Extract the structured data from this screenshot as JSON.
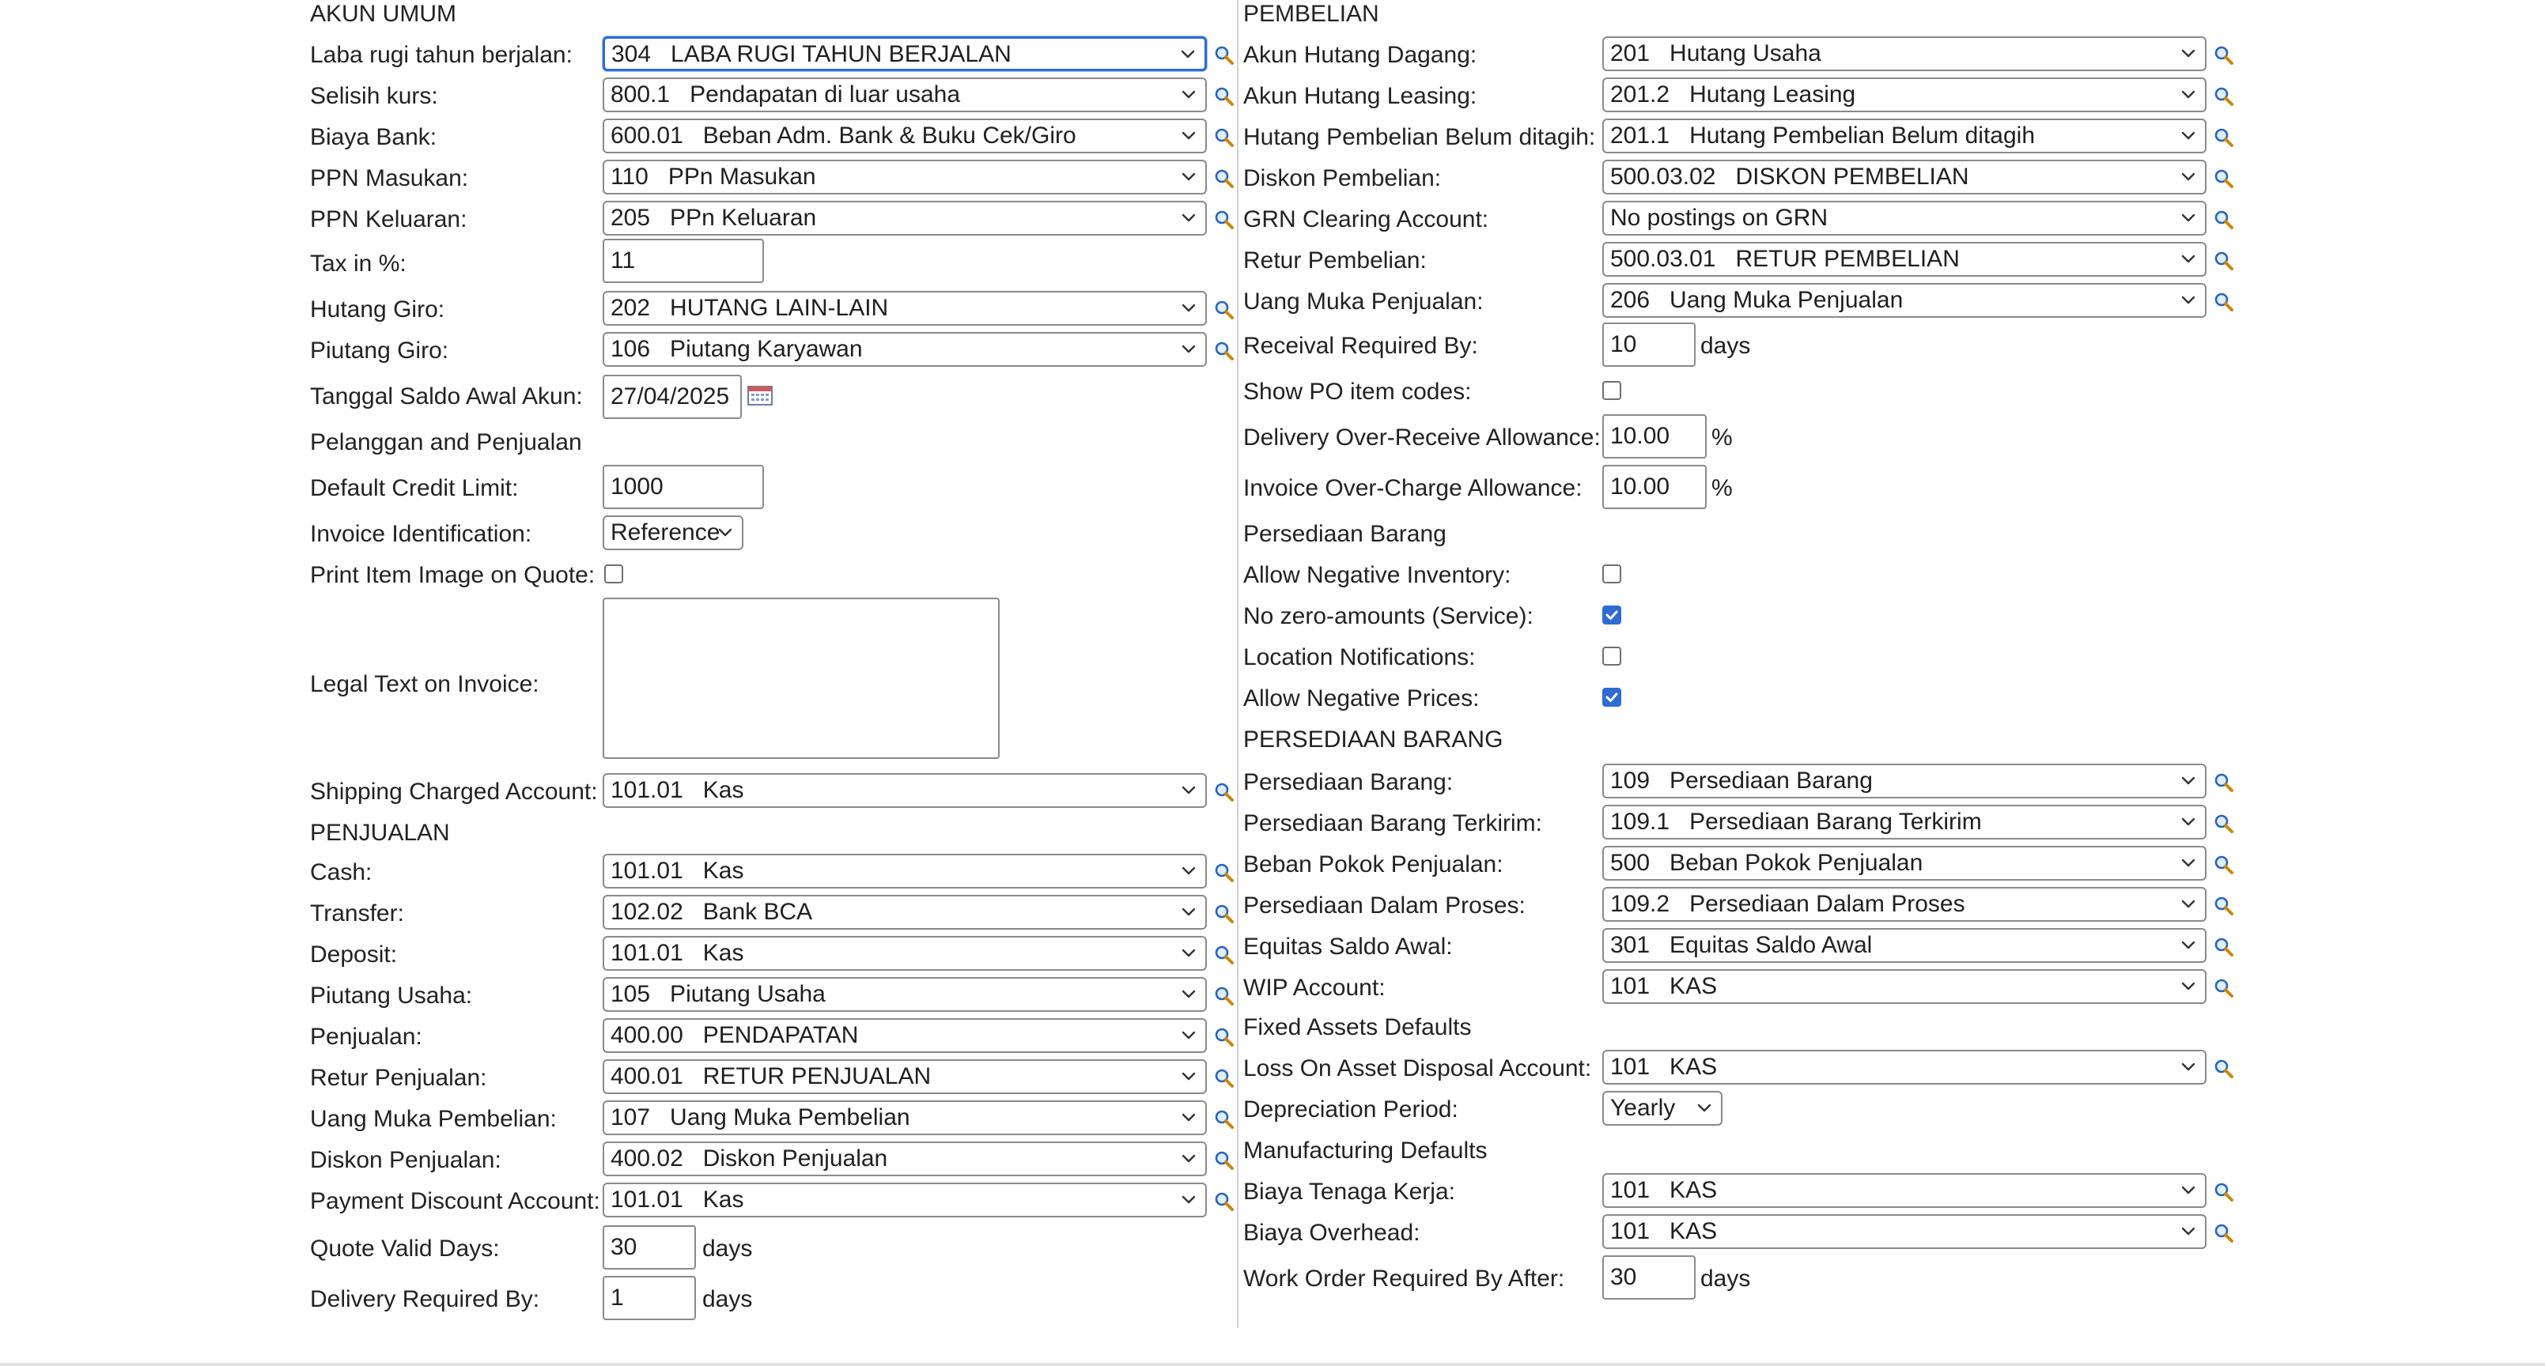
{
  "left": {
    "akun_umum_header": "AKUN UMUM",
    "laba_rugi_label": "Laba rugi tahun berjalan:",
    "laba_rugi_value": "304   LABA RUGI TAHUN BERJALAN",
    "selisih_kurs_label": "Selisih kurs:",
    "selisih_kurs_value": "800.1   Pendapatan di luar usaha",
    "biaya_bank_label": "Biaya Bank:",
    "biaya_bank_value": "600.01   Beban Adm. Bank & Buku Cek/Giro",
    "ppn_masukan_label": "PPN Masukan:",
    "ppn_masukan_value": "110   PPn Masukan",
    "ppn_keluaran_label": "PPN Keluaran:",
    "ppn_keluaran_value": "205   PPn Keluaran",
    "tax_label": "Tax in %:",
    "tax_value": "11",
    "hutang_giro_label": "Hutang Giro:",
    "hutang_giro_value": "202   HUTANG LAIN-LAIN",
    "piutang_giro_label": "Piutang Giro:",
    "piutang_giro_value": "106   Piutang Karyawan",
    "tanggal_label": "Tanggal Saldo Awal Akun:",
    "tanggal_value": "27/04/2025",
    "pelanggan_header": "Pelanggan and Penjualan",
    "credit_limit_label": "Default Credit Limit:",
    "credit_limit_value": "1000",
    "invoice_id_label": "Invoice Identification:",
    "invoice_id_value": "Reference",
    "print_image_label": "Print Item Image on Quote:",
    "legal_text_label": "Legal Text on Invoice:",
    "shipping_label": "Shipping Charged Account:",
    "shipping_value": "101.01   Kas",
    "penjualan_header": "PENJUALAN",
    "cash_label": "Cash:",
    "cash_value": "101.01   Kas",
    "transfer_label": "Transfer:",
    "transfer_value": "102.02   Bank BCA",
    "deposit_label": "Deposit:",
    "deposit_value": "101.01   Kas",
    "piutang_usaha_label": "Piutang Usaha:",
    "piutang_usaha_value": "105   Piutang Usaha",
    "penjualan_label": "Penjualan:",
    "penjualan_value": "400.00   PENDAPATAN",
    "retur_penjualan_label": "Retur Penjualan:",
    "retur_penjualan_value": "400.01   RETUR PENJUALAN",
    "uang_muka_pembelian_label": "Uang Muka Pembelian:",
    "uang_muka_pembelian_value": "107   Uang Muka Pembelian",
    "diskon_penjualan_label": "Diskon Penjualan:",
    "diskon_penjualan_value": "400.02   Diskon Penjualan",
    "payment_discount_label": "Payment Discount Account:",
    "payment_discount_value": "101.01   Kas",
    "quote_valid_label": "Quote Valid Days:",
    "quote_valid_value": "30",
    "delivery_required_label": "Delivery Required By:",
    "delivery_required_value": "1",
    "days": "days"
  },
  "right": {
    "pembelian_header": "PEMBELIAN",
    "hutang_dagang_label": "Akun Hutang Dagang:",
    "hutang_dagang_value": "201   Hutang Usaha",
    "hutang_leasing_label": "Akun Hutang Leasing:",
    "hutang_leasing_value": "201.2   Hutang Leasing",
    "hutang_pembelian_label": "Hutang Pembelian Belum ditagih:",
    "hutang_pembelian_value": "201.1   Hutang Pembelian Belum ditagih",
    "diskon_pembelian_label": "Diskon Pembelian:",
    "diskon_pembelian_value": "500.03.02   DISKON PEMBELIAN",
    "grn_label": "GRN Clearing Account:",
    "grn_value": "No postings on GRN",
    "retur_pembelian_label": "Retur Pembelian:",
    "retur_pembelian_value": "500.03.01   RETUR PEMBELIAN",
    "uang_muka_penjualan_label": "Uang Muka Penjualan:",
    "uang_muka_penjualan_value": "206   Uang Muka Penjualan",
    "receival_label": "Receival Required By:",
    "receival_value": "10",
    "show_po_label": "Show PO item codes:",
    "over_receive_label": "Delivery Over-Receive Allowance:",
    "over_receive_value": "10.00",
    "over_charge_label": "Invoice Over-Charge Allowance:",
    "over_charge_value": "10.00",
    "percent": "%",
    "persediaan_header": "Persediaan Barang",
    "neg_inventory_label": "Allow Negative Inventory:",
    "no_zero_label": "No zero-amounts (Service):",
    "location_notif_label": "Location Notifications:",
    "neg_prices_label": "Allow Negative Prices:",
    "persediaan_upper_header": "PERSEDIAAN BARANG",
    "persediaan_barang_label": "Persediaan Barang:",
    "persediaan_barang_value": "109   Persediaan Barang",
    "terkirim_label": "Persediaan Barang Terkirim:",
    "terkirim_value": "109.1   Persediaan Barang Terkirim",
    "beban_pokok_label": "Beban Pokok Penjualan:",
    "beban_pokok_value": "500   Beban Pokok Penjualan",
    "dalam_proses_label": "Persediaan Dalam Proses:",
    "dalam_proses_value": "109.2   Persediaan Dalam Proses",
    "equitas_label": "Equitas Saldo Awal:",
    "equitas_value": "301   Equitas Saldo Awal",
    "wip_label": "WIP Account:",
    "wip_value": "101   KAS",
    "fixed_assets_header": "Fixed Assets Defaults",
    "loss_disposal_label": "Loss On Asset Disposal Account:",
    "loss_disposal_value": "101   KAS",
    "depreciation_label": "Depreciation Period:",
    "depreciation_value": "Yearly",
    "manufacturing_header": "Manufacturing Defaults",
    "tenaga_kerja_label": "Biaya Tenaga Kerja:",
    "tenaga_kerja_value": "101   KAS",
    "overhead_label": "Biaya Overhead:",
    "overhead_value": "101   KAS",
    "work_order_label": "Work Order Required By After:",
    "work_order_value": "30",
    "days": "days"
  },
  "checkboxes": {
    "print_image": false,
    "show_po": false,
    "neg_inventory": false,
    "no_zero": true,
    "location_notif": false,
    "neg_prices": true
  },
  "colors": {
    "focus_border": "#2f6bd1",
    "checkbox_checked": "#2f6bd1"
  },
  "icons": {
    "lookup": "magnifier-icon",
    "dropdown": "chevron-down-icon",
    "calendar": "calendar-icon",
    "checkmark": "checkmark-icon"
  }
}
